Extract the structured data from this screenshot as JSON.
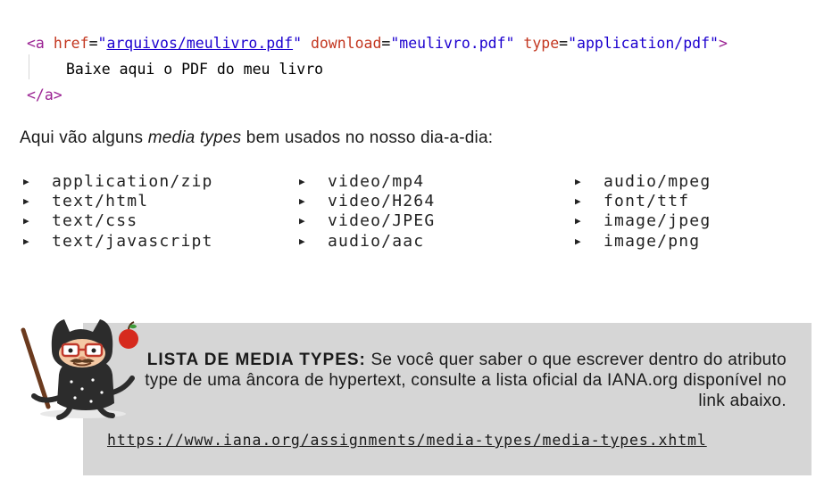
{
  "code": {
    "tag_open": "<a",
    "attr_href": "href",
    "href_value": "arquivos/meulivro.pdf",
    "attr_download": "download",
    "download_value": "meulivro.pdf",
    "attr_type": "type",
    "type_value": "application/pdf",
    "content": "Baixe aqui o PDF do meu livro",
    "tag_close": "</a>"
  },
  "intro": {
    "before": "Aqui vão alguns ",
    "emphasis": "media types",
    "after": " bem usados no nosso dia-a-dia:"
  },
  "media_types": {
    "col1": [
      "application/zip",
      "text/html",
      "text/css",
      "text/javascript"
    ],
    "col2": [
      "video/mp4",
      "video/H264",
      "video/JPEG",
      "audio/aac"
    ],
    "col3": [
      "audio/mpeg",
      "font/ttf",
      "image/jpeg",
      "image/png"
    ]
  },
  "callout": {
    "lead": "LISTA DE MEDIA TYPES:",
    "text": " Se você quer saber o que escrever dentro do atributo type de uma âncora de hypertext, consulte a lista oficial da IANA.org disponível no link abaixo.",
    "link": "https://www.iana.org/assignments/media-types/media-types.xhtml"
  }
}
